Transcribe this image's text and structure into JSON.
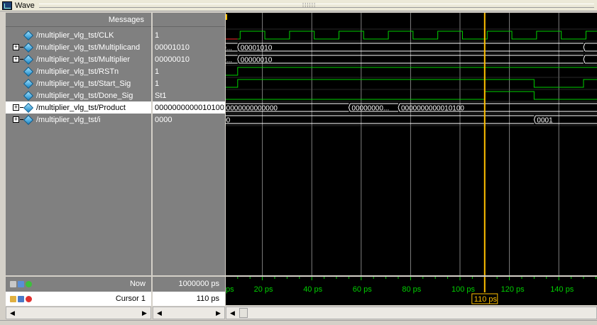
{
  "window": {
    "title": "Wave"
  },
  "columns": {
    "messages": "Messages"
  },
  "signals": [
    {
      "name": "/multiplier_vlg_tst/CLK",
      "value": "1",
      "expandable": false
    },
    {
      "name": "/multiplier_vlg_tst/Multiplicand",
      "value": "00001010",
      "expandable": true
    },
    {
      "name": "/multiplier_vlg_tst/Multiplier",
      "value": "00000010",
      "expandable": true
    },
    {
      "name": "/multiplier_vlg_tst/RSTn",
      "value": "1",
      "expandable": false
    },
    {
      "name": "/multiplier_vlg_tst/Start_Sig",
      "value": "1",
      "expandable": false
    },
    {
      "name": "/multiplier_vlg_tst/Done_Sig",
      "value": "St1",
      "expandable": false
    },
    {
      "name": "/multiplier_vlg_tst/Product",
      "value": "0000000000010100",
      "expandable": true,
      "selected": true
    },
    {
      "name": "/multiplier_vlg_tst/i",
      "value": "0000",
      "expandable": true
    }
  ],
  "bus_labels": {
    "multiplicand": [
      "000...",
      "00001010"
    ],
    "multiplier": [
      "000...",
      "00000010"
    ],
    "product": [
      "0000000000000000",
      "00000000...",
      "0000000000010100"
    ],
    "i": [
      "0000",
      "0001"
    ]
  },
  "now": {
    "label": "Now",
    "value": "1000000 ps"
  },
  "cursor": {
    "label": "Cursor 1",
    "value": "110 ps",
    "marker": "110 ps"
  },
  "timeline": {
    "ticks": [
      "ps",
      "20 ps",
      "40 ps",
      "60 ps",
      "80 ps",
      "100 ps",
      "120 ps",
      "140 ps"
    ]
  },
  "colors": {
    "wave": "#00d000",
    "cursor": "#ffc000",
    "bus": "#ffffff",
    "reset_red": "#ff3030",
    "grid": "#808080"
  }
}
